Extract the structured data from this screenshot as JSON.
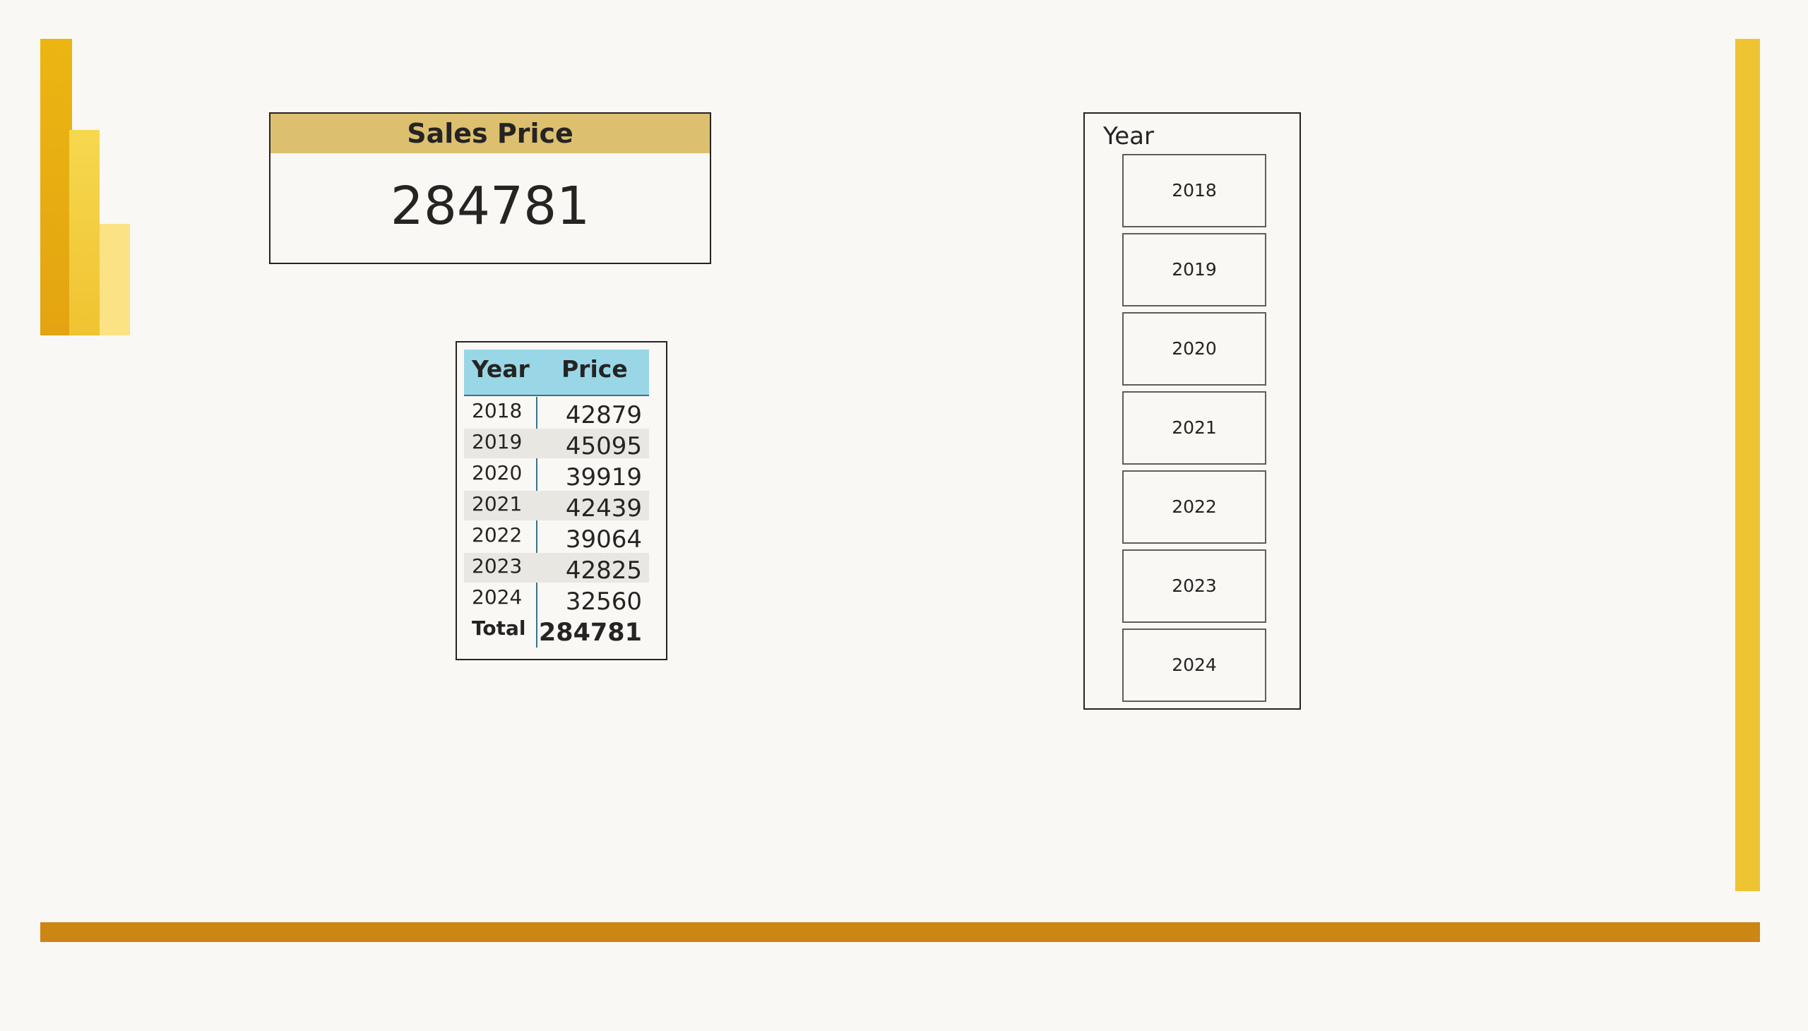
{
  "kpi": {
    "title": "Sales Price",
    "value": "284781"
  },
  "table": {
    "headers": {
      "year": "Year",
      "price": "Price"
    },
    "rows": [
      {
        "year": "2018",
        "price": "42879"
      },
      {
        "year": "2019",
        "price": "45095"
      },
      {
        "year": "2020",
        "price": "39919"
      },
      {
        "year": "2021",
        "price": "42439"
      },
      {
        "year": "2022",
        "price": "39064"
      },
      {
        "year": "2023",
        "price": "42825"
      },
      {
        "year": "2024",
        "price": "32560"
      }
    ],
    "total": {
      "label": "Total",
      "value": "284781"
    }
  },
  "slicer": {
    "title": "Year",
    "items": [
      "2018",
      "2019",
      "2020",
      "2021",
      "2022",
      "2023",
      "2024"
    ]
  },
  "colors": {
    "background": "#f9f8f4",
    "kpi_header": "#dcc06f",
    "table_header": "#9ad7e6",
    "accent_gold": "#eec432",
    "accent_orange": "#cc8614"
  },
  "icons": {
    "logo": "power-bi-logo-icon"
  }
}
